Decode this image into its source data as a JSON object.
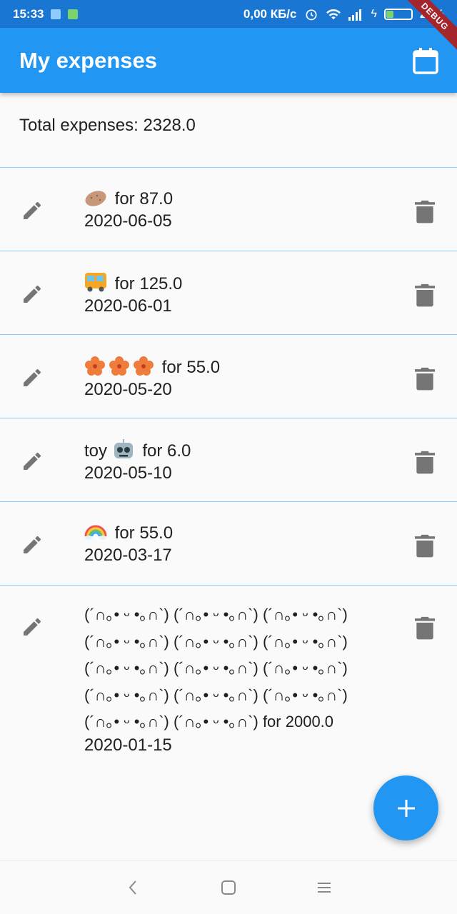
{
  "status_bar": {
    "time": "15:33",
    "network_speed": "0,00 КБ/с",
    "battery_percent": "29%",
    "battery_level": 0.29,
    "debug_label": "DEBUG"
  },
  "app_bar": {
    "title": "My expenses",
    "calendar_icon": "calendar-icon"
  },
  "total": {
    "text": "Total expenses: 2328.0"
  },
  "expenses": [
    {
      "prefix": "",
      "emoji": "potato",
      "suffix": "for 87.0",
      "date": "2020-06-05"
    },
    {
      "prefix": "",
      "emoji": "bus",
      "suffix": "for 125.0",
      "date": "2020-06-01"
    },
    {
      "prefix": "",
      "emoji": "hibiscus-x3",
      "suffix": "for 55.0",
      "date": "2020-05-20"
    },
    {
      "prefix": "toy",
      "emoji": "robot",
      "suffix": "for 6.0",
      "date": "2020-05-10"
    },
    {
      "prefix": "",
      "emoji": "rainbow",
      "suffix": "for 55.0",
      "date": "2020-03-17"
    },
    {
      "lines": [
        "(´∩｡• ᵕ •｡∩`) (´∩｡• ᵕ •｡∩`) (´∩｡• ᵕ •｡∩`)",
        "(´∩｡• ᵕ •｡∩`) (´∩｡• ᵕ •｡∩`) (´∩｡• ᵕ •｡∩`)",
        "(´∩｡• ᵕ •｡∩`) (´∩｡• ᵕ •｡∩`) (´∩｡• ᵕ •｡∩`)",
        "(´∩｡• ᵕ •｡∩`) (´∩｡• ᵕ •｡∩`) (´∩｡• ᵕ •｡∩`)",
        "(´∩｡• ᵕ •｡∩`) (´∩｡• ᵕ •｡∩`)  for 2000.0"
      ],
      "date": "2020-01-15"
    }
  ],
  "icons": {
    "edit": "pencil-icon",
    "delete": "trash-icon",
    "add": "plus-icon"
  },
  "colors": {
    "primary": "#2196f3",
    "status_bar": "#1976d2",
    "divider": "#90caf9",
    "icon_grey": "#757575"
  }
}
